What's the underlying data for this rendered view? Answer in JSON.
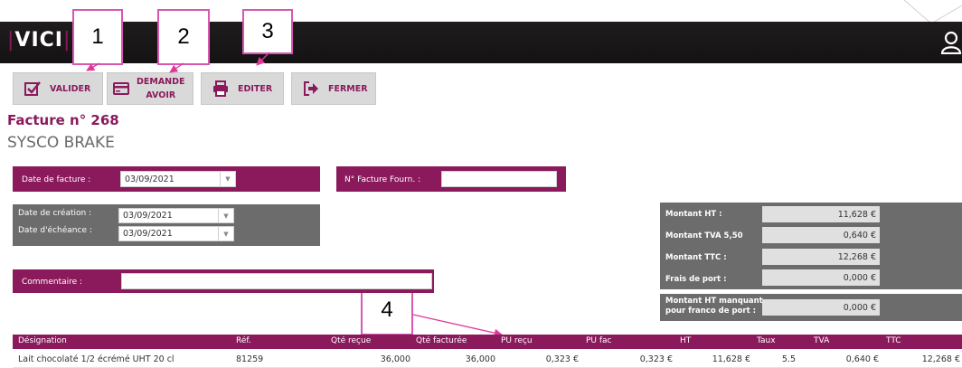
{
  "app": {
    "logo": "VICI"
  },
  "toolbar": {
    "valider": "VALIDER",
    "demande_avoir_line1": "DEMANDE",
    "demande_avoir_line2": "AVOIR",
    "editer": "EDITER",
    "fermer": "FERMER"
  },
  "callouts": [
    "1",
    "2",
    "3",
    "4"
  ],
  "invoice": {
    "title": "Facture n° 268",
    "supplier": "SYSCO BRAKE",
    "date_facture_label": "Date de facture :",
    "date_facture_value": "03/09/2021",
    "n_facture_label": "N° Facture Fourn. :",
    "n_facture_value": "",
    "date_creation_label": "Date de création :",
    "date_creation_value": "03/09/2021",
    "date_echeance_label": "Date d'échéance :",
    "date_echeance_value": "03/09/2021",
    "commentaire_label": "Commentaire :",
    "commentaire_value": ""
  },
  "totals": [
    {
      "label": "Montant HT :",
      "value": "11,628 €"
    },
    {
      "label": "Montant TVA 5,50",
      "value": "0,640 €"
    },
    {
      "label": "Montant TTC :",
      "value": "12,268 €"
    },
    {
      "label": "Frais de port :",
      "value": "0,000 €"
    }
  ],
  "franco": {
    "label_line1": "Montant HT manquant",
    "label_line2": "pour franco de port :",
    "value": "0,000 €"
  },
  "table": {
    "headers": [
      "Désignation",
      "Réf.",
      "Qté reçue",
      "Qté facturée",
      "PU reçu",
      "PU fac",
      "HT",
      "Taux",
      "TVA",
      "TTC"
    ],
    "rows": [
      [
        "Lait chocolaté 1/2 écrémé UHT 20 cl",
        "81259",
        "36,000",
        "36,000",
        "0,323 €",
        "0,323 €",
        "11,628 €",
        "5.5",
        "0,640 €",
        "12,268 €"
      ]
    ]
  },
  "colors": {
    "accent": "#8a1a5c",
    "panel_grey": "#6c6c6c",
    "callout_border": "#d857b2",
    "arrow": "#e0399a"
  },
  "icons": [
    "check-square-icon",
    "credit-card-icon",
    "printer-icon",
    "exit-icon",
    "user-icon"
  ]
}
